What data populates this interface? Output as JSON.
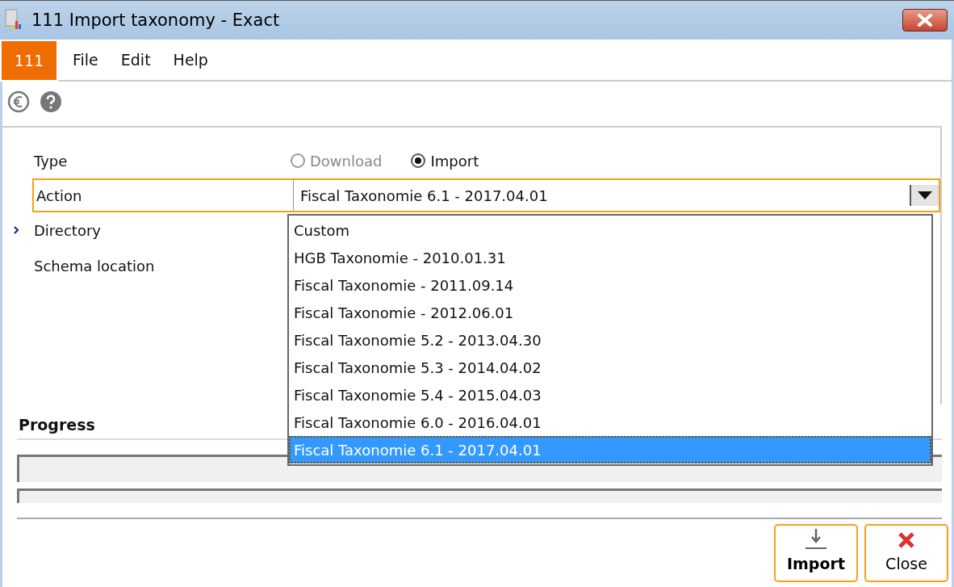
{
  "window": {
    "title": "111 Import taxonomy - Exact"
  },
  "menu": {
    "badge": "111",
    "items": [
      {
        "label": "File"
      },
      {
        "label": "Edit"
      },
      {
        "label": "Help"
      }
    ]
  },
  "form": {
    "fields": [
      {
        "kind": "radio",
        "label": "Type",
        "current": false,
        "options": [
          {
            "label": "Download",
            "selected": false,
            "disabled": true
          },
          {
            "label": "Import",
            "selected": true,
            "disabled": false
          }
        ]
      },
      {
        "kind": "dropdown",
        "label": "Action",
        "current": false,
        "focused": true,
        "value": "Fiscal Taxonomie 6.1 - 2017.04.01",
        "expanded": true
      },
      {
        "kind": "text",
        "label": "Directory",
        "current": true
      },
      {
        "kind": "text",
        "label": "Schema location",
        "current": false
      }
    ]
  },
  "dropdown_list": [
    {
      "label": "Custom",
      "selected": false
    },
    {
      "label": "HGB Taxonomie - 2010.01.31",
      "selected": false
    },
    {
      "label": "Fiscal Taxonomie - 2011.09.14",
      "selected": false
    },
    {
      "label": "Fiscal Taxonomie - 2012.06.01",
      "selected": false
    },
    {
      "label": "Fiscal Taxonomie 5.2 - 2013.04.30",
      "selected": false
    },
    {
      "label": "Fiscal Taxonomie 5.3 - 2014.04.02",
      "selected": false
    },
    {
      "label": "Fiscal Taxonomie 5.4 - 2015.04.03",
      "selected": false
    },
    {
      "label": "Fiscal Taxonomie 6.0 - 2016.04.01",
      "selected": false
    },
    {
      "label": "Fiscal Taxonomie 6.1 - 2017.04.01",
      "selected": true
    }
  ],
  "progress": {
    "title": "Progress",
    "bars": [
      {
        "level": 0
      },
      {
        "level": 0
      }
    ]
  },
  "buttons": [
    {
      "kind": "import",
      "label": "Import"
    },
    {
      "kind": "close",
      "label": "Close"
    }
  ]
}
